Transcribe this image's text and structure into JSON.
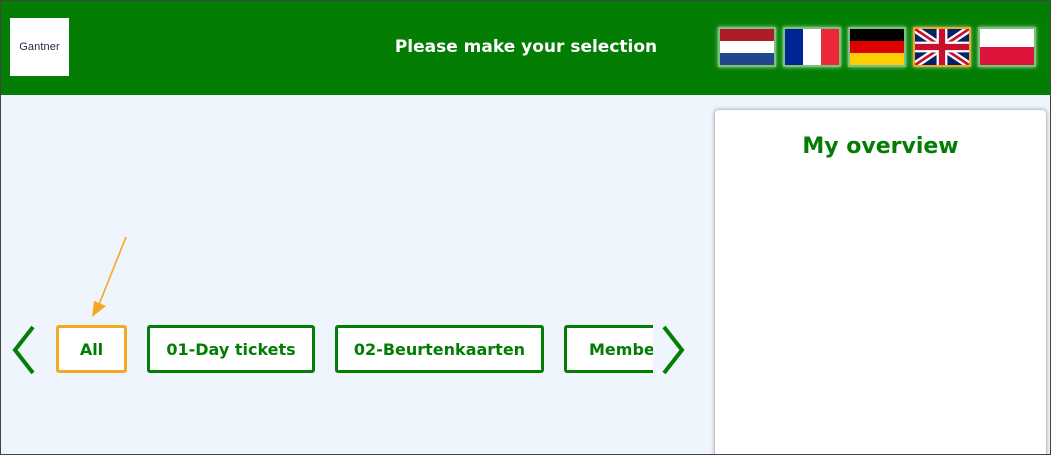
{
  "header": {
    "logo_text": "Gantner",
    "title": "Please make your selection",
    "languages": [
      {
        "code": "nl",
        "name": "Dutch"
      },
      {
        "code": "fr",
        "name": "French"
      },
      {
        "code": "de",
        "name": "German"
      },
      {
        "code": "en",
        "name": "English",
        "active": true
      },
      {
        "code": "pl",
        "name": "Polish"
      }
    ]
  },
  "categories": {
    "items": [
      {
        "label": "All",
        "selected": true
      },
      {
        "label": "01-Day tickets"
      },
      {
        "label": "02-Beurtenkaarten"
      },
      {
        "label": "Membe"
      }
    ]
  },
  "overview": {
    "title": "My overview"
  },
  "colors": {
    "brand_green": "#037d03",
    "accent_orange": "#f5a623",
    "background": "#eef5fc"
  }
}
